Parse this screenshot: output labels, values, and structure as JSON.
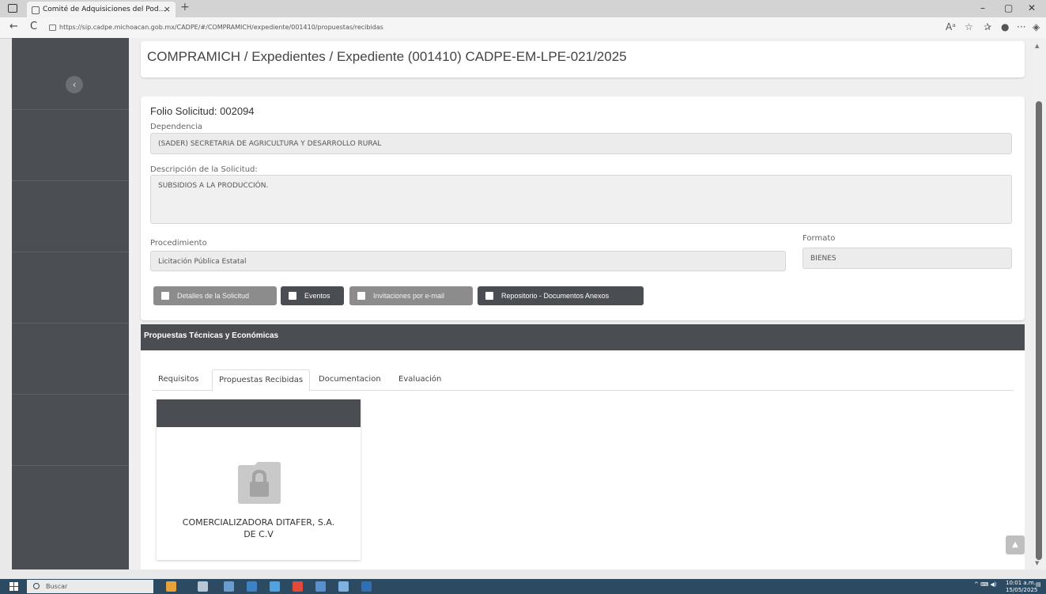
{
  "browser": {
    "tab_title": "Comité de Adquisiciones del Pod...",
    "tab_close": "×",
    "new_tab": "+",
    "url": "https://sip.cadpe.michoacan.gob.mx/CADPE/#/COMPRAMICH/expediente/001410/propuestas/recibidas",
    "win_min": "–",
    "win_max": "▢",
    "win_close": "✕",
    "back": "←",
    "reload": "C",
    "more": "···"
  },
  "breadcrumb": "COMPRAMICH / Expedientes / Expediente (001410) CADPE-EM-LPE-021/2025",
  "request": {
    "folio": "Folio Solicitud: 002094",
    "dependencia_label": "Dependencia",
    "dependencia_value": "(SADER) SECRETARIA DE AGRICULTURA Y DESARROLLO RURAL",
    "descripcion_label": "Descripción de la Solicitud:",
    "descripcion_value": "SUBSIDIOS A LA PRODUCCIÓN.",
    "procedimiento_label": "Procedimiento",
    "procedimiento_value": "Licitación Pública Estatal",
    "formato_label": "Formato",
    "formato_value": "BIENES"
  },
  "actions": {
    "detalles": "Detalles de la Solicitud",
    "eventos": "Eventos",
    "invitaciones": "Invitaciones por e-mail",
    "repositorio": "Repositorio - Documentos Anexos"
  },
  "panel": {
    "title": "Propuestas Técnicas y Económicas",
    "tabs": [
      "Requisitos",
      "Propuestas Recibidas",
      "Documentacion",
      "Evaluación"
    ],
    "active_tab": "Propuestas Recibidas",
    "proposals": [
      {
        "company_line1": "COMERCIALIZADORA DITAFER, S.A.",
        "company_line2": "DE C.V",
        "icon": "locked-folder-icon"
      }
    ]
  },
  "taskbar": {
    "search_placeholder": "Buscar",
    "time": "10:01 a.m.",
    "date": "15/05/2025"
  },
  "colors": {
    "sidebar": "#4b4e52",
    "panel_header": "#4a4d52",
    "button_grey": "#8c8c8c",
    "button_dark": "#4a4d52",
    "taskbar": "#2d4a63"
  }
}
